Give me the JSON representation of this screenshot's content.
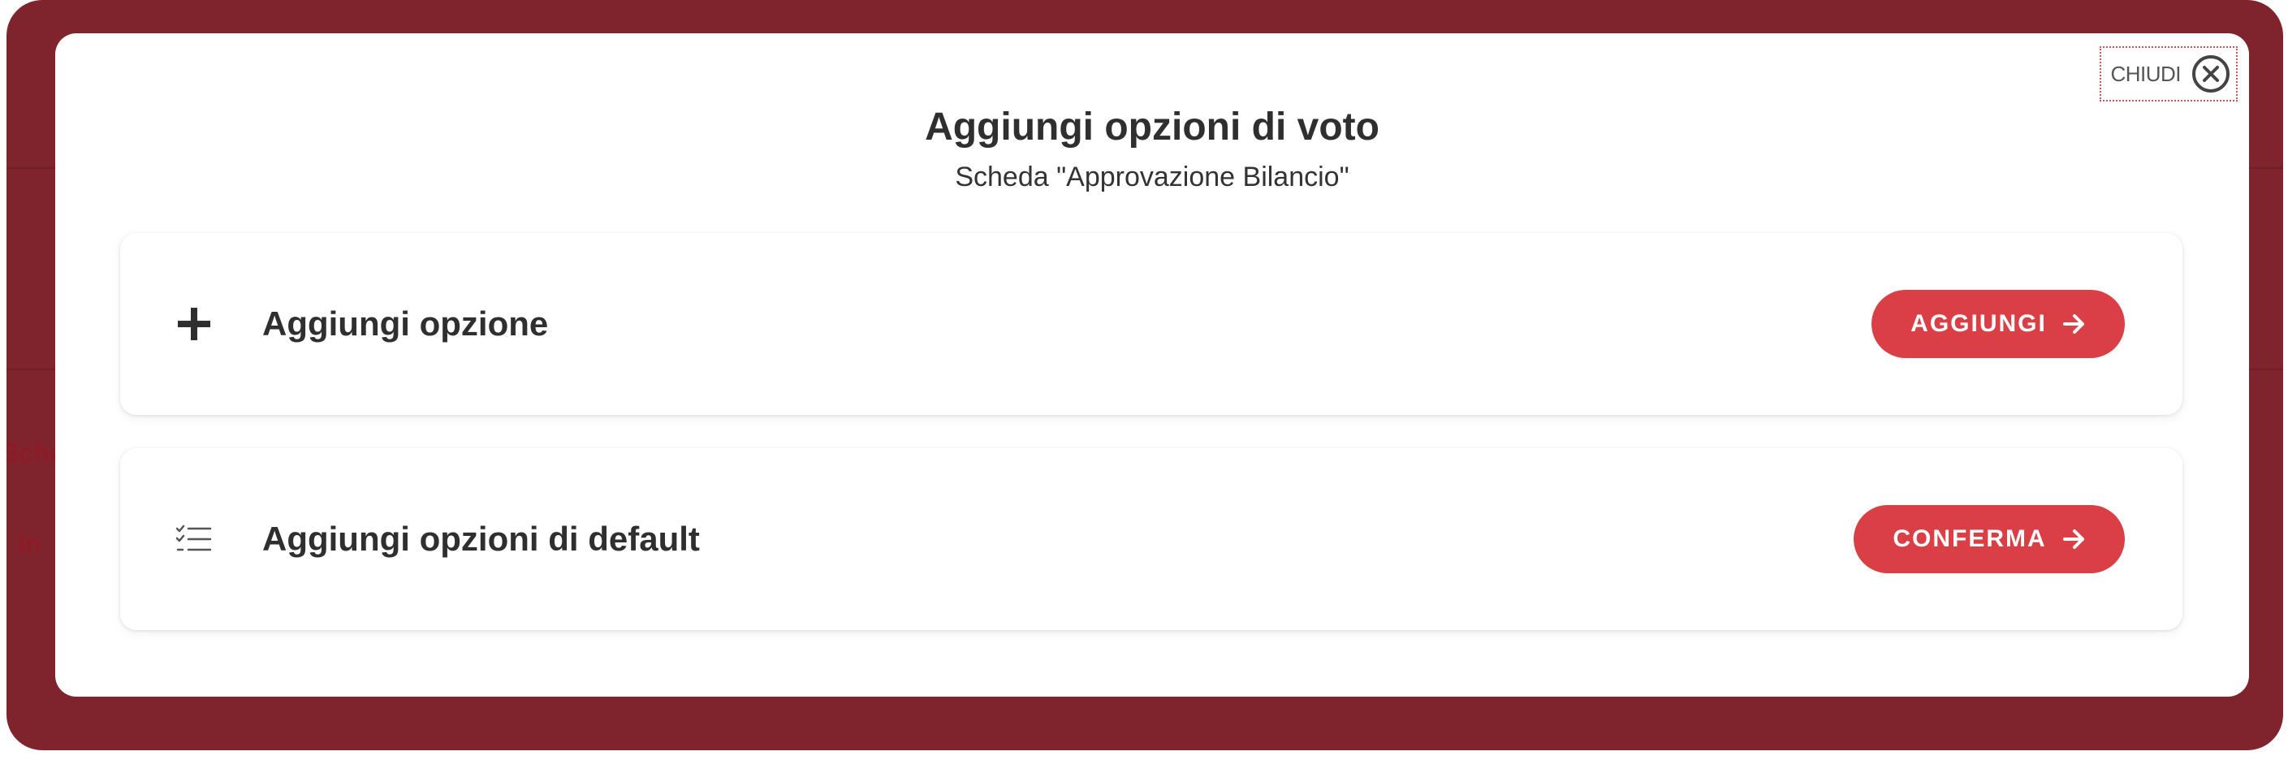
{
  "background": {
    "overlay_color": "#7f232c",
    "fragment_1": "Sche",
    "fragment_2": "In"
  },
  "modal": {
    "close_label": "CHIUDI",
    "title": "Aggiungi opzioni di voto",
    "subtitle": "Scheda \"Approvazione Bilancio\""
  },
  "cards": [
    {
      "icon": "plus-icon",
      "label": "Aggiungi opzione",
      "button_label": "AGGIUNGI",
      "button_icon": "arrow-right-icon"
    },
    {
      "icon": "checklist-icon",
      "label": "Aggiungi opzioni di default",
      "button_label": "CONFERMA",
      "button_icon": "arrow-right-icon"
    }
  ],
  "colors": {
    "accent": "#d93f44",
    "text": "#2f2f2f"
  }
}
